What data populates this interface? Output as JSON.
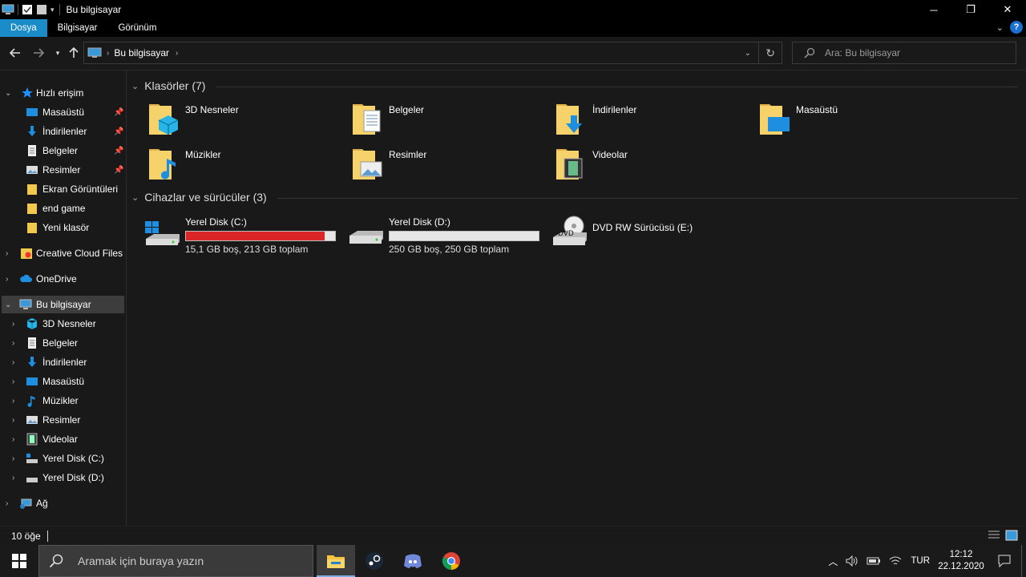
{
  "window": {
    "title": "Bu bilgisayar",
    "minimize": "─",
    "restore": "❐",
    "close": "✕"
  },
  "ribbon": {
    "tabs": [
      "Dosya",
      "Bilgisayar",
      "Görünüm"
    ],
    "help": "?"
  },
  "address": {
    "crumb": "Bu bilgisayar",
    "search_placeholder": "Ara: Bu bilgisayar"
  },
  "sidebar": {
    "quick_access": "Hızlı erişim",
    "quick_items": [
      "Masaüstü",
      "İndirilenler",
      "Belgeler",
      "Resimler",
      "Ekran Görüntüleri",
      "end game",
      "Yeni klasör"
    ],
    "creative_cloud": "Creative Cloud Files",
    "onedrive": "OneDrive",
    "this_pc": "Bu bilgisayar",
    "pc_items": [
      "3D Nesneler",
      "Belgeler",
      "İndirilenler",
      "Masaüstü",
      "Müzikler",
      "Resimler",
      "Videolar",
      "Yerel Disk (C:)",
      "Yerel Disk (D:)"
    ],
    "network": "Ağ"
  },
  "main": {
    "folders_header": "Klasörler (7)",
    "folders": [
      "3D Nesneler",
      "Belgeler",
      "İndirilenler",
      "Masaüstü",
      "Müzikler",
      "Resimler",
      "Videolar"
    ],
    "devices_header": "Cihazlar ve sürücüler (3)",
    "drives": [
      {
        "name": "Yerel Disk (C:)",
        "size": "15,1 GB boş, 213 GB toplam",
        "used_fraction": 0.93,
        "bar_color": "#da2626"
      },
      {
        "name": "Yerel Disk (D:)",
        "size": "250 GB boş, 250 GB toplam",
        "used_fraction": 0.0,
        "bar_color": "#26a0da"
      },
      {
        "name": "DVD RW Sürücüsü (E:)"
      }
    ],
    "dvd_text": "DVD"
  },
  "status": {
    "count": "10 öğe"
  },
  "taskbar": {
    "search_placeholder": "Aramak için buraya yazın",
    "language": "TUR",
    "time": "12:12",
    "date": "22.12.2020"
  }
}
